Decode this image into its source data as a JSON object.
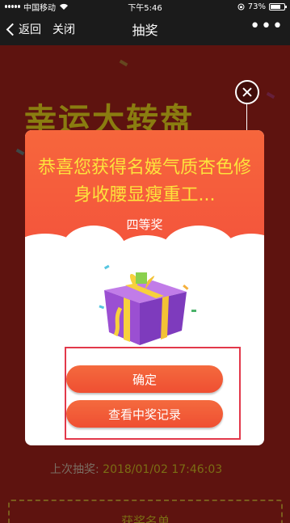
{
  "status_bar": {
    "carrier": "中国移动",
    "time": "下午5:46",
    "battery": "73%",
    "battery_level": 0.73
  },
  "nav": {
    "back_label": "返回",
    "close_label": "关闭",
    "title": "抽奖",
    "more_label": "•••"
  },
  "background": {
    "title": "幸运大转盘",
    "last_draw_label": "上次抽奖:",
    "last_draw_time": "2018/01/02 17:46:03",
    "winners_label": "获奖名单"
  },
  "modal": {
    "prize_name": "恭喜您获得名媛气质杏色修身收腰显瘦重工...",
    "prize_level": "四等奖",
    "confirm_label": "确定",
    "record_label": "查看中奖记录"
  },
  "colors": {
    "accent": "#f4543c",
    "prize_text": "#fde23c",
    "highlight_frame": "#e2384a"
  },
  "icons": {
    "close": "close-icon",
    "back": "chevron-left-icon",
    "gift": "gift-box-icon",
    "wifi": "wifi-icon",
    "battery": "battery-icon"
  }
}
